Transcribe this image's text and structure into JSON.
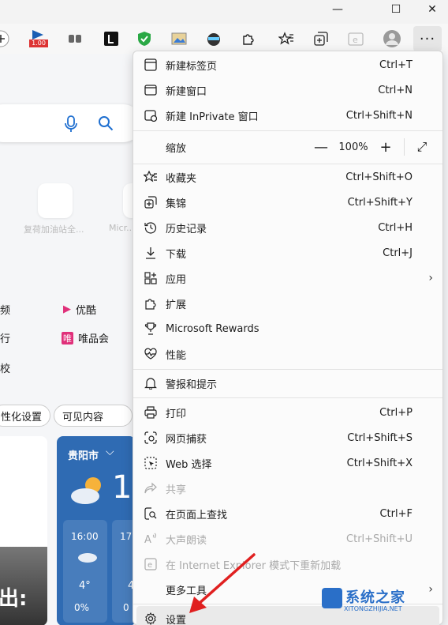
{
  "window": {
    "minimize": "—",
    "maximize": "☐",
    "close": "✕"
  },
  "toolbar": {
    "badge": "1.00",
    "more": "···"
  },
  "page": {
    "tile_label_1": "复荷加油站全...",
    "tile_label_2": "Micr...",
    "links": [
      {
        "left": "频",
        "right": "优酷"
      },
      {
        "left": "行",
        "right": "唯品会"
      },
      {
        "left": "校",
        "right": ""
      }
    ],
    "pill_personalize": "性化设置",
    "pill_visible": "可见内容",
    "weather_city": "贵阳市",
    "weather_temp": "1",
    "forecast": [
      {
        "time": "16:00",
        "temp": "4°",
        "rain": "0%"
      },
      {
        "time": "17:",
        "temp": "4",
        "rain": "0"
      }
    ],
    "news_big": "出:"
  },
  "menu": {
    "new_tab": {
      "label": "新建标签页",
      "shortcut": "Ctrl+T"
    },
    "new_window": {
      "label": "新建窗口",
      "shortcut": "Ctrl+N"
    },
    "new_inprivate": {
      "label": "新建 InPrivate 窗口",
      "shortcut": "Ctrl+Shift+N"
    },
    "zoom": {
      "label": "缩放",
      "minus": "—",
      "value": "100%",
      "plus": "+",
      "fullscreen": "⤢"
    },
    "favorites": {
      "label": "收藏夹",
      "shortcut": "Ctrl+Shift+O"
    },
    "collections": {
      "label": "集锦",
      "shortcut": "Ctrl+Shift+Y"
    },
    "history": {
      "label": "历史记录",
      "shortcut": "Ctrl+H"
    },
    "downloads": {
      "label": "下载",
      "shortcut": "Ctrl+J"
    },
    "apps": {
      "label": "应用"
    },
    "extensions": {
      "label": "扩展"
    },
    "rewards": {
      "label": "Microsoft Rewards"
    },
    "performance": {
      "label": "性能"
    },
    "alerts": {
      "label": "警报和提示"
    },
    "print": {
      "label": "打印",
      "shortcut": "Ctrl+P"
    },
    "web_capture": {
      "label": "网页捕获",
      "shortcut": "Ctrl+Shift+S"
    },
    "web_select": {
      "label": "Web 选择",
      "shortcut": "Ctrl+Shift+X"
    },
    "share": {
      "label": "共享"
    },
    "find": {
      "label": "在页面上查找",
      "shortcut": "Ctrl+F"
    },
    "read_aloud": {
      "label": "大声朗读",
      "shortcut": "Ctrl+Shift+U"
    },
    "ie_mode": {
      "label": "在 Internet Explorer 模式下重新加载"
    },
    "more_tools": {
      "label": "更多工具"
    },
    "settings": {
      "label": "设置"
    }
  },
  "watermark": {
    "title": "系统之家",
    "url": "XITONGZHIJIA.NET"
  },
  "colors": {
    "accent": "#1f6fd0",
    "arrow": "#e02020",
    "weather_bg": "#2f6bb3"
  }
}
